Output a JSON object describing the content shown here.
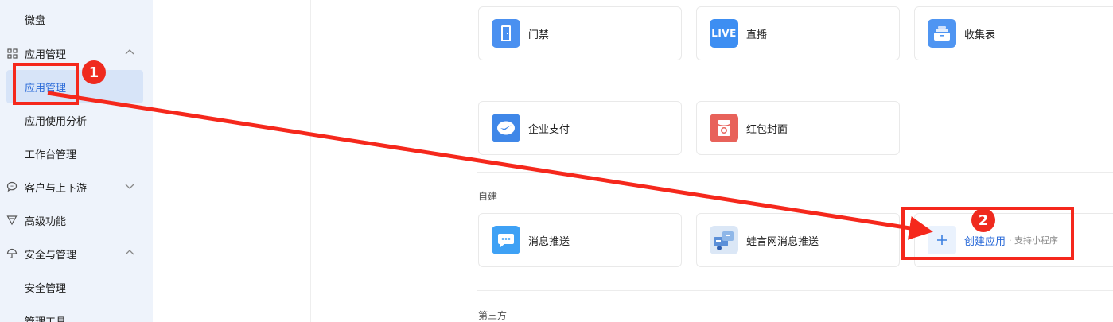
{
  "sidebar": {
    "items": [
      {
        "label": "微盘"
      },
      {
        "label": "应用管理"
      },
      {
        "label": "应用管理"
      },
      {
        "label": "应用使用分析"
      },
      {
        "label": "工作台管理"
      },
      {
        "label": "客户与上下游"
      },
      {
        "label": "高级功能"
      },
      {
        "label": "安全与管理"
      },
      {
        "label": "安全管理"
      },
      {
        "label": "管理工具"
      }
    ]
  },
  "main": {
    "apps_row1": [
      {
        "name": "门禁",
        "icon": "door-icon",
        "color": "#4a90f0"
      },
      {
        "name": "直播",
        "icon": "live-icon",
        "icon_text": "LIVE",
        "color": "#3d8ef2"
      },
      {
        "name": "收集表",
        "icon": "collect-form-icon",
        "color": "#4f95f2"
      }
    ],
    "apps_row2": [
      {
        "name": "企业支付",
        "icon": "enterprise-pay-icon",
        "color": "#3f87e8"
      },
      {
        "name": "红包封面",
        "icon": "red-packet-cover-icon",
        "color": "#e8625a"
      }
    ],
    "self_built_label": "自建",
    "apps_self": [
      {
        "name": "消息推送",
        "icon": "message-push-icon",
        "color": "#3ea1f5"
      },
      {
        "name": "蛙言网消息推送",
        "icon": "wayan-push-icon",
        "color": "#8fb7e8"
      }
    ],
    "create_app": {
      "label": "创建应用",
      "sub": "· 支持小程序"
    },
    "third_party_label": "第三方"
  },
  "annotations": {
    "badge1": "1",
    "badge2": "2",
    "color": "#f5281c"
  }
}
